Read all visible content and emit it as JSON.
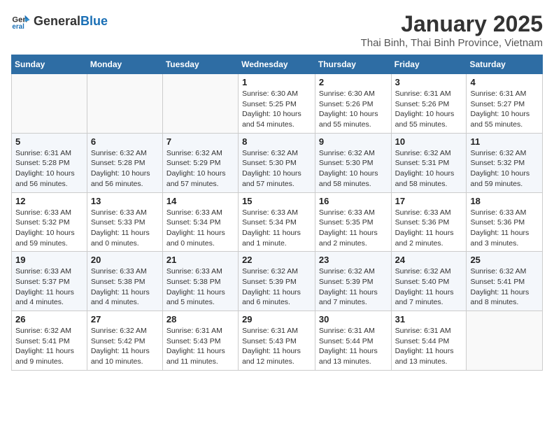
{
  "header": {
    "logo_general": "General",
    "logo_blue": "Blue",
    "month": "January 2025",
    "location": "Thai Binh, Thai Binh Province, Vietnam"
  },
  "weekdays": [
    "Sunday",
    "Monday",
    "Tuesday",
    "Wednesday",
    "Thursday",
    "Friday",
    "Saturday"
  ],
  "weeks": [
    [
      {
        "day": "",
        "info": ""
      },
      {
        "day": "",
        "info": ""
      },
      {
        "day": "",
        "info": ""
      },
      {
        "day": "1",
        "info": "Sunrise: 6:30 AM\nSunset: 5:25 PM\nDaylight: 10 hours\nand 54 minutes."
      },
      {
        "day": "2",
        "info": "Sunrise: 6:30 AM\nSunset: 5:26 PM\nDaylight: 10 hours\nand 55 minutes."
      },
      {
        "day": "3",
        "info": "Sunrise: 6:31 AM\nSunset: 5:26 PM\nDaylight: 10 hours\nand 55 minutes."
      },
      {
        "day": "4",
        "info": "Sunrise: 6:31 AM\nSunset: 5:27 PM\nDaylight: 10 hours\nand 55 minutes."
      }
    ],
    [
      {
        "day": "5",
        "info": "Sunrise: 6:31 AM\nSunset: 5:28 PM\nDaylight: 10 hours\nand 56 minutes."
      },
      {
        "day": "6",
        "info": "Sunrise: 6:32 AM\nSunset: 5:28 PM\nDaylight: 10 hours\nand 56 minutes."
      },
      {
        "day": "7",
        "info": "Sunrise: 6:32 AM\nSunset: 5:29 PM\nDaylight: 10 hours\nand 57 minutes."
      },
      {
        "day": "8",
        "info": "Sunrise: 6:32 AM\nSunset: 5:30 PM\nDaylight: 10 hours\nand 57 minutes."
      },
      {
        "day": "9",
        "info": "Sunrise: 6:32 AM\nSunset: 5:30 PM\nDaylight: 10 hours\nand 58 minutes."
      },
      {
        "day": "10",
        "info": "Sunrise: 6:32 AM\nSunset: 5:31 PM\nDaylight: 10 hours\nand 58 minutes."
      },
      {
        "day": "11",
        "info": "Sunrise: 6:32 AM\nSunset: 5:32 PM\nDaylight: 10 hours\nand 59 minutes."
      }
    ],
    [
      {
        "day": "12",
        "info": "Sunrise: 6:33 AM\nSunset: 5:32 PM\nDaylight: 10 hours\nand 59 minutes."
      },
      {
        "day": "13",
        "info": "Sunrise: 6:33 AM\nSunset: 5:33 PM\nDaylight: 11 hours\nand 0 minutes."
      },
      {
        "day": "14",
        "info": "Sunrise: 6:33 AM\nSunset: 5:34 PM\nDaylight: 11 hours\nand 0 minutes."
      },
      {
        "day": "15",
        "info": "Sunrise: 6:33 AM\nSunset: 5:34 PM\nDaylight: 11 hours\nand 1 minute."
      },
      {
        "day": "16",
        "info": "Sunrise: 6:33 AM\nSunset: 5:35 PM\nDaylight: 11 hours\nand 2 minutes."
      },
      {
        "day": "17",
        "info": "Sunrise: 6:33 AM\nSunset: 5:36 PM\nDaylight: 11 hours\nand 2 minutes."
      },
      {
        "day": "18",
        "info": "Sunrise: 6:33 AM\nSunset: 5:36 PM\nDaylight: 11 hours\nand 3 minutes."
      }
    ],
    [
      {
        "day": "19",
        "info": "Sunrise: 6:33 AM\nSunset: 5:37 PM\nDaylight: 11 hours\nand 4 minutes."
      },
      {
        "day": "20",
        "info": "Sunrise: 6:33 AM\nSunset: 5:38 PM\nDaylight: 11 hours\nand 4 minutes."
      },
      {
        "day": "21",
        "info": "Sunrise: 6:33 AM\nSunset: 5:38 PM\nDaylight: 11 hours\nand 5 minutes."
      },
      {
        "day": "22",
        "info": "Sunrise: 6:32 AM\nSunset: 5:39 PM\nDaylight: 11 hours\nand 6 minutes."
      },
      {
        "day": "23",
        "info": "Sunrise: 6:32 AM\nSunset: 5:39 PM\nDaylight: 11 hours\nand 7 minutes."
      },
      {
        "day": "24",
        "info": "Sunrise: 6:32 AM\nSunset: 5:40 PM\nDaylight: 11 hours\nand 7 minutes."
      },
      {
        "day": "25",
        "info": "Sunrise: 6:32 AM\nSunset: 5:41 PM\nDaylight: 11 hours\nand 8 minutes."
      }
    ],
    [
      {
        "day": "26",
        "info": "Sunrise: 6:32 AM\nSunset: 5:41 PM\nDaylight: 11 hours\nand 9 minutes."
      },
      {
        "day": "27",
        "info": "Sunrise: 6:32 AM\nSunset: 5:42 PM\nDaylight: 11 hours\nand 10 minutes."
      },
      {
        "day": "28",
        "info": "Sunrise: 6:31 AM\nSunset: 5:43 PM\nDaylight: 11 hours\nand 11 minutes."
      },
      {
        "day": "29",
        "info": "Sunrise: 6:31 AM\nSunset: 5:43 PM\nDaylight: 11 hours\nand 12 minutes."
      },
      {
        "day": "30",
        "info": "Sunrise: 6:31 AM\nSunset: 5:44 PM\nDaylight: 11 hours\nand 13 minutes."
      },
      {
        "day": "31",
        "info": "Sunrise: 6:31 AM\nSunset: 5:44 PM\nDaylight: 11 hours\nand 13 minutes."
      },
      {
        "day": "",
        "info": ""
      }
    ]
  ]
}
